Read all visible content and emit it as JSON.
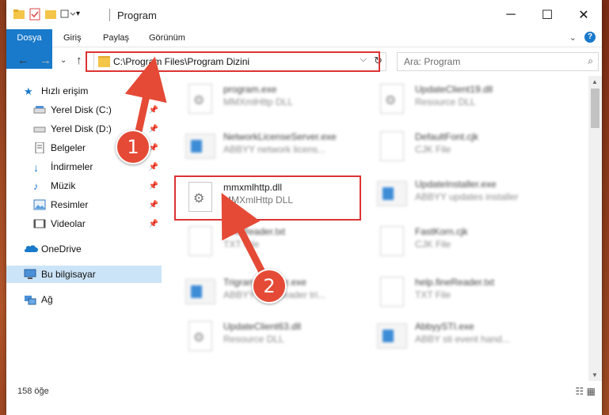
{
  "window": {
    "title": "Program",
    "controls": {
      "minimize": "─",
      "maximize": "☐",
      "close": "✕"
    }
  },
  "ribbon": {
    "tabs": [
      "Dosya",
      "Giriş",
      "Paylaş",
      "Görünüm"
    ]
  },
  "nav": {
    "address_path": "C:\\Program Files\\Program Dizini",
    "search_placeholder": "Ara: Program"
  },
  "sidebar": {
    "quick_access": "Hızlı erişim",
    "items": [
      {
        "label": "Yerel Disk (C:)",
        "icon": "drive-icon",
        "pinned": true
      },
      {
        "label": "Yerel Disk (D:)",
        "icon": "drive-icon",
        "pinned": true
      },
      {
        "label": "Belgeler",
        "icon": "documents-icon",
        "pinned": true
      },
      {
        "label": "İndirmeler",
        "icon": "download-icon",
        "pinned": true
      },
      {
        "label": "Müzik",
        "icon": "music-icon",
        "pinned": true
      },
      {
        "label": "Resimler",
        "icon": "pictures-icon",
        "pinned": true
      },
      {
        "label": "Videolar",
        "icon": "videos-icon",
        "pinned": true
      }
    ],
    "onedrive": "OneDrive",
    "this_pc": "Bu bilgisayar",
    "network": "Ağ"
  },
  "files": [
    {
      "name": "program.exe",
      "desc": "MMXmlHttp DLL",
      "icon": "dll-icon"
    },
    {
      "name": "UpdateClient19.dll",
      "desc": "Resource DLL",
      "icon": "dll-icon"
    },
    {
      "name": "NetworkLicenseServer.exe",
      "desc": "ABBYY network licens...",
      "icon": "exe-icon"
    },
    {
      "name": "DefaultFont.cjk",
      "desc": "CJK File",
      "icon": "file-icon"
    },
    {
      "name": "mmxmlhttp.dll",
      "desc": "MMXmlHttp DLL",
      "icon": "dll-icon"
    },
    {
      "name": "UpdateInstaller.exe",
      "desc": "ABBYY updates installer",
      "icon": "exe-icon"
    },
    {
      "name": "FineReader.txt",
      "desc": "TXT File",
      "icon": "file-icon"
    },
    {
      "name": "FastKorn.cjk",
      "desc": "CJK File",
      "icon": "file-icon"
    },
    {
      "name": "TrigramInstaller.exe",
      "desc": "ABBYY FineReader tri...",
      "icon": "exe-icon"
    },
    {
      "name": "help.fineReader.txt",
      "desc": "TXT File",
      "icon": "file-icon"
    },
    {
      "name": "UpdateClient63.dll",
      "desc": "Resource DLL",
      "icon": "dll-icon"
    },
    {
      "name": "AbbyySTI.exe",
      "desc": "ABBY sti event hand...",
      "icon": "exe-icon"
    }
  ],
  "status": {
    "count": "158 öğe"
  },
  "callouts": [
    "1",
    "2"
  ]
}
